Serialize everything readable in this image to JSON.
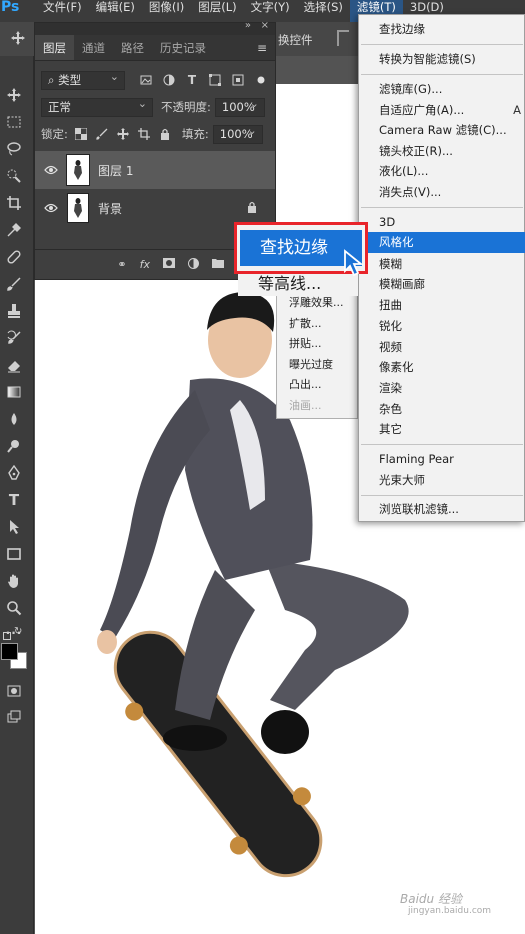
{
  "app": {
    "logo": "Ps"
  },
  "menubar": {
    "items": [
      "文件(F)",
      "编辑(E)",
      "图像(I)",
      "图层(L)",
      "文字(Y)",
      "选择(S)",
      "滤镜(T)",
      "3D(D)"
    ]
  },
  "options": {
    "label": "换控件"
  },
  "layers_panel": {
    "tabs": [
      "图层",
      "通道",
      "路径",
      "历史记录"
    ],
    "filter_type": "⌕ 类型",
    "blend_mode": "正常",
    "opacity_label": "不透明度:",
    "opacity_value": "100%",
    "lock_label": "锁定:",
    "fill_label": "填充:",
    "fill_value": "100%",
    "layers": [
      {
        "name": "图层 1",
        "selected": true
      },
      {
        "name": "背景",
        "locked": true
      }
    ],
    "footer_fx": "fx"
  },
  "filter_menu": {
    "items": [
      "查找边缘",
      "转换为智能滤镜(S)",
      "滤镜库(G)...",
      "自适应广角(A)...",
      "Camera Raw 滤镜(C)...",
      "镜头校正(R)...",
      "液化(L)...",
      "消失点(V)...",
      "3D",
      "风格化",
      "模糊",
      "模糊画廊",
      "扭曲",
      "锐化",
      "视频",
      "像素化",
      "渲染",
      "杂色",
      "其它",
      "Flaming Pear",
      "光束大师",
      "浏览联机滤镜..."
    ],
    "shortcut_hint": "A",
    "highlighted": "风格化"
  },
  "stylize_submenu": {
    "items": [
      "浮雕效果...",
      "扩散...",
      "拼贴...",
      "曝光过度",
      "凸出...",
      "油画..."
    ]
  },
  "callout": {
    "highlight": "查找边缘",
    "next": "等高线..."
  },
  "watermark": {
    "line1": "Baidu 经验",
    "line2": "jingyan.baidu.com"
  }
}
